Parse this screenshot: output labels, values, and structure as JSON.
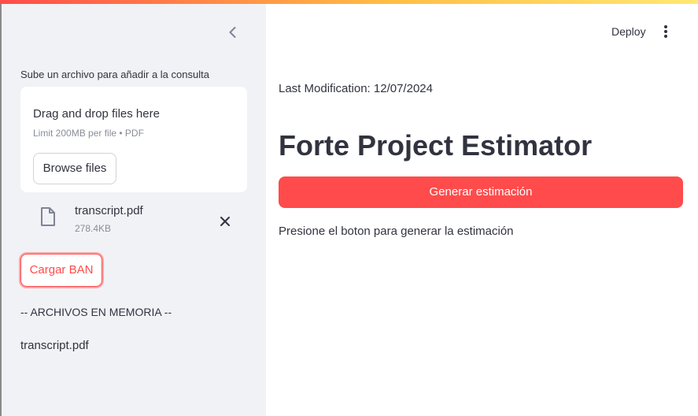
{
  "sidebar": {
    "upload_label": "Sube un archivo para añadir a la consulta",
    "dropzone": {
      "title": "Drag and drop files here",
      "limit": "Limit 200MB per file • PDF",
      "browse_label": "Browse files"
    },
    "uploaded_file": {
      "name": "transcript.pdf",
      "size": "278.4KB"
    },
    "load_button_label": "Cargar BAN",
    "memory_heading": "-- ARCHIVOS EN MEMORIA --",
    "memory_files": [
      "transcript.pdf"
    ]
  },
  "header": {
    "deploy_label": "Deploy"
  },
  "main": {
    "last_modification": "Last Modification: 12/07/2024",
    "title": "Forte Project Estimator",
    "generate_button_label": "Generar estimación",
    "info_text": "Presione el boton para generar la estimación"
  },
  "colors": {
    "primary": "#ff4b4b",
    "sidebar_bg": "#f0f2f6",
    "text": "#31333f"
  },
  "icons": [
    "chevron-left-icon",
    "file-icon",
    "close-icon",
    "vertical-dots-icon"
  ]
}
